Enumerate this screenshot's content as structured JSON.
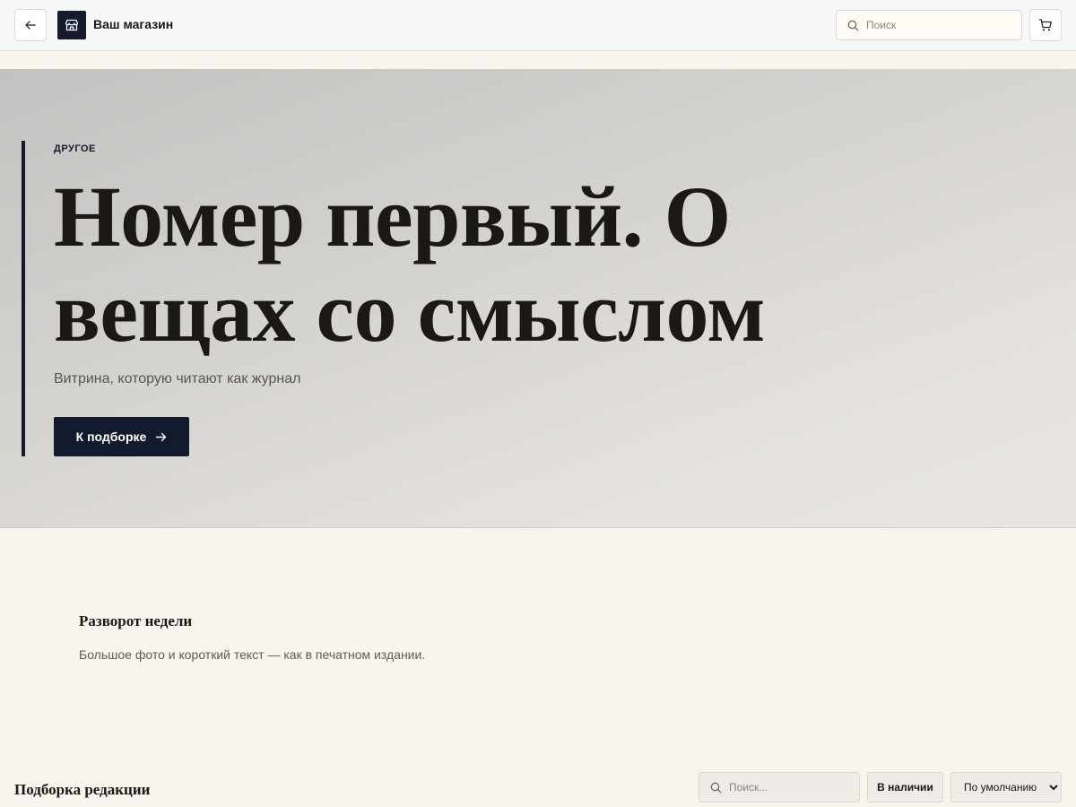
{
  "header": {
    "back_icon": "arrow-left-icon",
    "store_icon": "storefront-icon",
    "store_name": "Ваш магазин",
    "search": {
      "placeholder": "Поиск",
      "value": "",
      "icon": "search-icon"
    },
    "cart_icon": "shopping-cart-icon"
  },
  "hero": {
    "kicker": "ДРУГОЕ",
    "title": "Номер первый. О вещах со смыслом",
    "subtitle": "Витрина, которую читают как журнал",
    "cta_label": "К подборке",
    "cta_icon": "arrow-right-icon"
  },
  "feature": {
    "title": "Разворот недели",
    "description": "Большое фото и короткий текст — как в печатном издании."
  },
  "catalog": {
    "title": "Подборка редакции",
    "search": {
      "placeholder": "Поиск...",
      "value": "",
      "icon": "search-icon"
    },
    "in_stock_label": "В наличии",
    "sort": {
      "selected": "По умолчанию"
    }
  },
  "colors": {
    "accent": "#131a2c",
    "page_background": "#f9f4ee",
    "header_background": "#f6f8f8",
    "hero_gradient_start": "#c3c2c0",
    "hero_gradient_end": "#e9e6e1",
    "text_primary": "#1a1714",
    "text_muted": "#5a5651"
  }
}
